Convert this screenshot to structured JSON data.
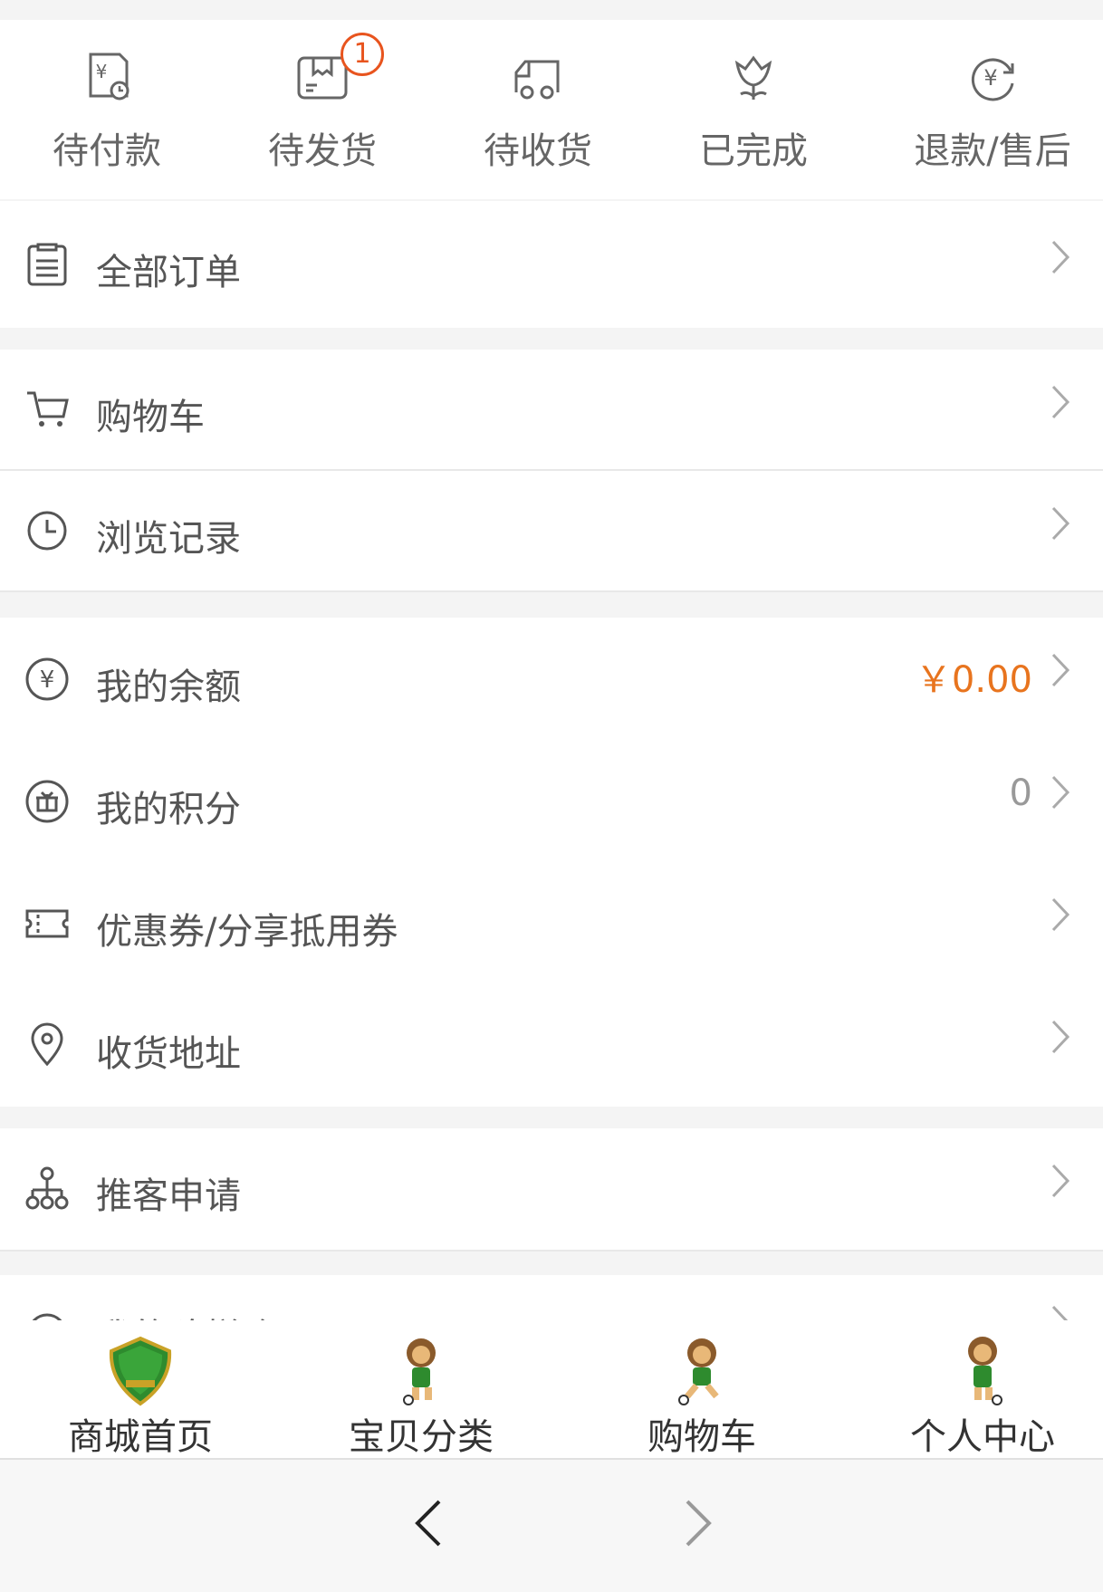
{
  "order_status": [
    {
      "label": "待付款",
      "icon": "payment-pending-icon"
    },
    {
      "label": "待发货",
      "icon": "package-icon",
      "badge": "1"
    },
    {
      "label": "待收货",
      "icon": "delivery-truck-icon"
    },
    {
      "label": "已完成",
      "icon": "completed-flower-icon"
    },
    {
      "label": "退款/售后",
      "icon": "refund-icon"
    }
  ],
  "menu": {
    "all_orders": "全部订单",
    "cart": "购物车",
    "history": "浏览记录",
    "balance": "我的余额",
    "balance_value": "￥0.00",
    "points": "我的积分",
    "points_value": "0",
    "coupons": "优惠券/分享抵用券",
    "address": "收货地址",
    "referral": "推客申请",
    "tiered": "我的阶梯购"
  },
  "tabbar": [
    {
      "label": "商城首页",
      "icon": "club-crest-logo"
    },
    {
      "label": "宝贝分类",
      "icon": "lion-mascot-icon"
    },
    {
      "label": "购物车",
      "icon": "lion-mascot-icon"
    },
    {
      "label": "个人中心",
      "icon": "lion-mascot-icon"
    }
  ],
  "colors": {
    "accent": "#e8741e",
    "badge": "#e8541e",
    "brand_green": "#2e8b2e"
  }
}
